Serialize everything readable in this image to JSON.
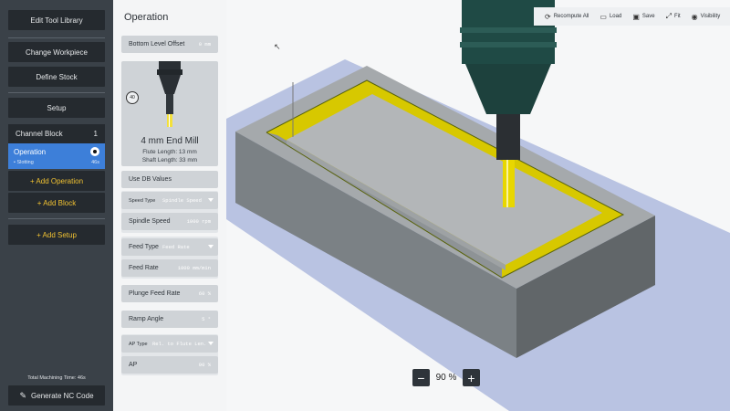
{
  "sidebar": {
    "edit_tool_library": "Edit Tool Library",
    "change_workpiece": "Change Workpiece",
    "define_stock": "Define Stock",
    "setup": "Setup",
    "channel_block": {
      "label": "Channel Block",
      "count": "1"
    },
    "operation": {
      "label": "Operation",
      "sub_label": "• Slotting",
      "sub_value": "46s"
    },
    "add_operation": "+ Add Operation",
    "add_block": "+ Add Block",
    "add_setup": "+ Add Setup",
    "total_time": "Total Machining Time: 46s",
    "generate_nc": "Generate NC Code"
  },
  "panel": {
    "title": "Operation",
    "bottom_level_offset": {
      "label": "Bottom Level Offset",
      "value": "0 mm"
    },
    "tool": {
      "badge": "40",
      "name": "4 mm End Mill",
      "flute_length": "Flute Length: 13 mm",
      "shaft_length": "Shaft Length: 33 mm"
    },
    "use_db_values": "Use DB Values",
    "speed_type": {
      "label": "Speed Type",
      "value": "Spindle Speed"
    },
    "spindle_speed": {
      "label": "Spindle Speed",
      "value": "1000 rpm"
    },
    "feed_type": {
      "label": "Feed Type",
      "value": "Feed Rate"
    },
    "feed_rate": {
      "label": "Feed Rate",
      "value": "1000 mm/min"
    },
    "plunge_feed_rate": {
      "label": "Plunge Feed Rate",
      "value": "60 %"
    },
    "ramp_angle": {
      "label": "Ramp Angle",
      "value": "5 °"
    },
    "ap_type": {
      "label": "AP Type",
      "value": "Rel. to Flute Len."
    },
    "ap": {
      "label": "AP",
      "value": "90 %"
    }
  },
  "toolbar": {
    "recompute_all": "Recompute All",
    "load": "Load",
    "save": "Save",
    "fit": "Fit",
    "visibility": "Visibility"
  },
  "zoom": {
    "minus": "−",
    "value": "90 %",
    "plus": "+"
  },
  "colors": {
    "sidebar_bg": "#3a4148",
    "button_bg": "#252a2f",
    "accent_yellow": "#f1c232",
    "selection_blue": "#3d7fd9",
    "tool_teal": "#1f4a45"
  }
}
